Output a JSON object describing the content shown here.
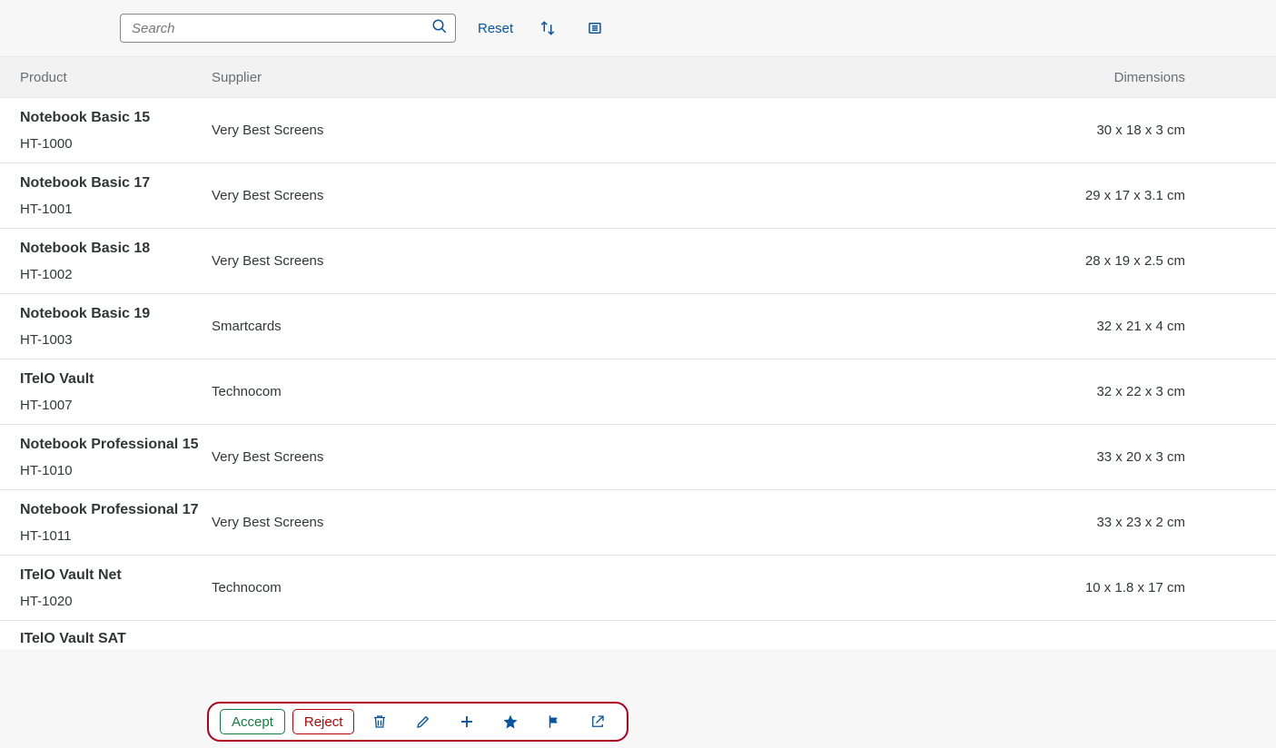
{
  "toolbar": {
    "search_placeholder": "Search",
    "reset_label": "Reset"
  },
  "table": {
    "headers": {
      "product": "Product",
      "supplier": "Supplier",
      "dimensions": "Dimensions"
    },
    "rows": [
      {
        "name": "Notebook Basic 15",
        "id": "HT-1000",
        "supplier": "Very Best Screens",
        "dimensions": "30 x 18 x 3 cm"
      },
      {
        "name": "Notebook Basic 17",
        "id": "HT-1001",
        "supplier": "Very Best Screens",
        "dimensions": "29 x 17 x 3.1 cm"
      },
      {
        "name": "Notebook Basic 18",
        "id": "HT-1002",
        "supplier": "Very Best Screens",
        "dimensions": "28 x 19 x 2.5 cm"
      },
      {
        "name": "Notebook Basic 19",
        "id": "HT-1003",
        "supplier": "Smartcards",
        "dimensions": "32 x 21 x 4 cm"
      },
      {
        "name": "ITelO Vault",
        "id": "HT-1007",
        "supplier": "Technocom",
        "dimensions": "32 x 22 x 3 cm"
      },
      {
        "name": "Notebook Professional 15",
        "id": "HT-1010",
        "supplier": "Very Best Screens",
        "dimensions": "33 x 20 x 3 cm"
      },
      {
        "name": "Notebook Professional 17",
        "id": "HT-1011",
        "supplier": "Very Best Screens",
        "dimensions": "33 x 23 x 2 cm"
      },
      {
        "name": "ITelO Vault Net",
        "id": "HT-1020",
        "supplier": "Technocom",
        "dimensions": "10 x 1.8 x 17 cm"
      },
      {
        "name": "ITelO Vault SAT",
        "id": "",
        "supplier": "",
        "dimensions": ""
      }
    ]
  },
  "footer": {
    "accept_label": "Accept",
    "reject_label": "Reject"
  }
}
